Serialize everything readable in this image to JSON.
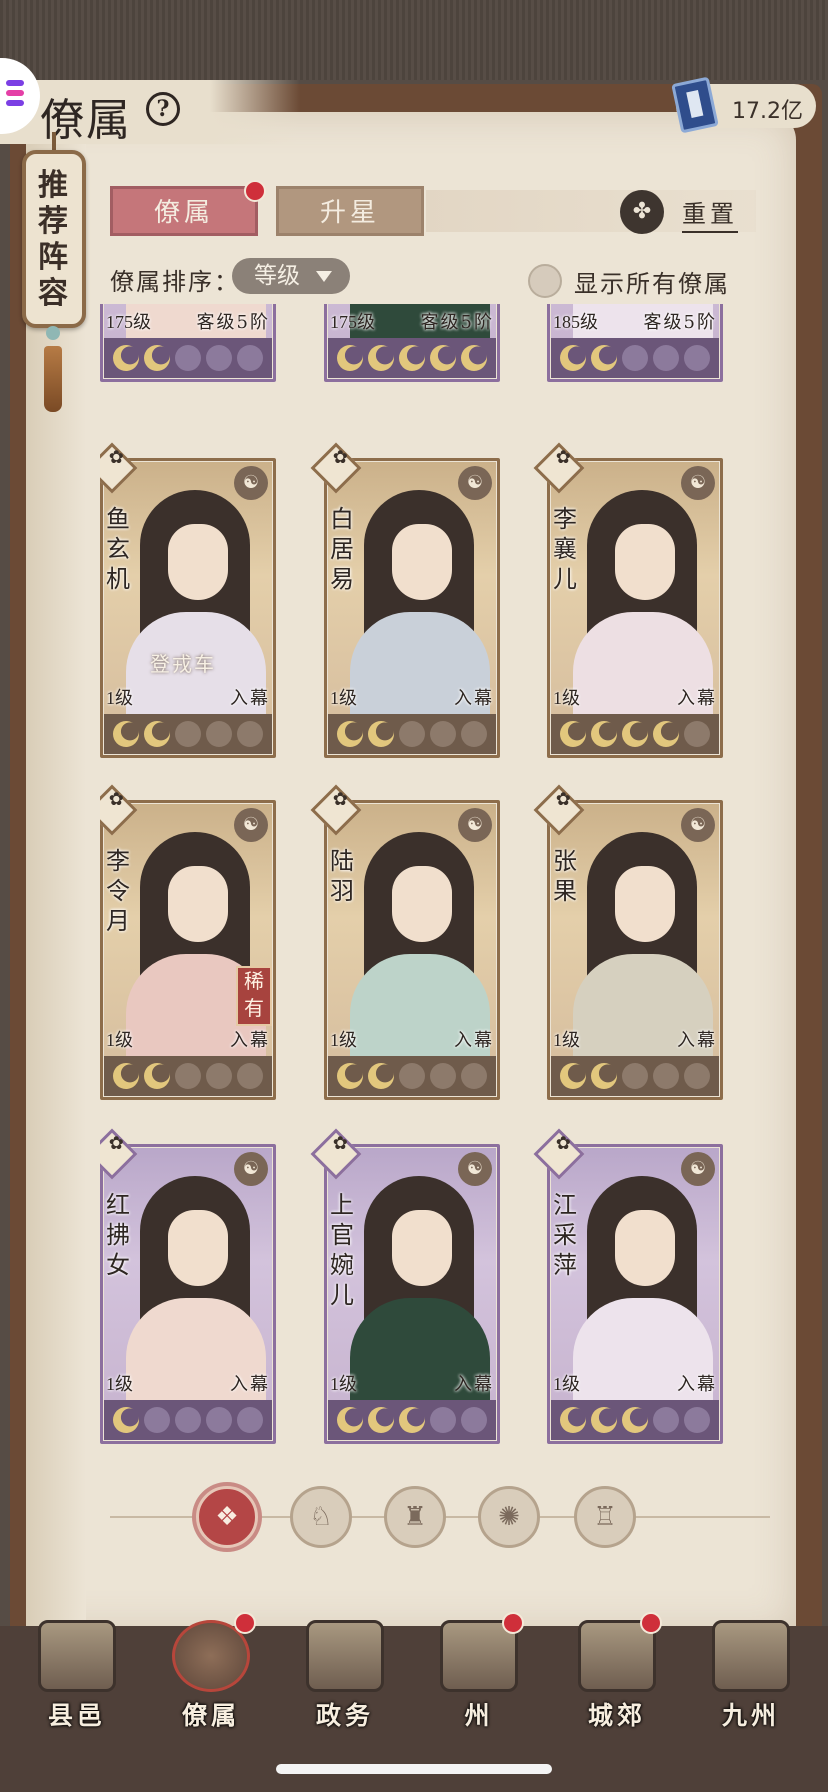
{
  "header": {
    "title": "僚属",
    "help_icon": "question-icon",
    "currency_icon": "book-icon",
    "currency_amount": "17.2亿"
  },
  "recommend": {
    "label": "推荐阵容"
  },
  "tabs": [
    {
      "label": "僚属",
      "active": true,
      "has_dot": true
    },
    {
      "label": "升星",
      "active": false,
      "has_dot": false
    }
  ],
  "reset": {
    "label": "重置",
    "icon": "leaf-icon"
  },
  "sort": {
    "label": "僚属排序：",
    "selected": "等级"
  },
  "show_all": {
    "label": "显示所有僚属",
    "checked": false
  },
  "cards": [
    {
      "name": "",
      "level": "175级",
      "status": "客级5阶",
      "moons": [
        1,
        1,
        0,
        0,
        0
      ],
      "theme": "purple"
    },
    {
      "name": "",
      "level": "175级",
      "status": "客级5阶",
      "moons": [
        1,
        1,
        1,
        1,
        1
      ],
      "theme": "purple"
    },
    {
      "name": "",
      "level": "185级",
      "status": "客级5阶",
      "moons": [
        1,
        1,
        0,
        0,
        0
      ],
      "theme": "purple"
    },
    {
      "name": "鱼玄机",
      "level": "1级",
      "status": "入幕",
      "moons": [
        1,
        1,
        0,
        0,
        0
      ],
      "theme": "gold",
      "tag": "登戎车"
    },
    {
      "name": "白居易",
      "level": "1级",
      "status": "入幕",
      "moons": [
        1,
        1,
        0,
        0,
        0
      ],
      "theme": "gold"
    },
    {
      "name": "李襄儿",
      "level": "1级",
      "status": "入幕",
      "moons": [
        1,
        1,
        1,
        1,
        0
      ],
      "theme": "gold"
    },
    {
      "name": "李令月",
      "level": "1级",
      "status": "入幕",
      "moons": [
        1,
        1,
        0,
        0,
        0
      ],
      "theme": "gold",
      "rarity": "稀有"
    },
    {
      "name": "陆羽",
      "level": "1级",
      "status": "入幕",
      "moons": [
        1,
        1,
        0,
        0,
        0
      ],
      "theme": "gold"
    },
    {
      "name": "张果",
      "level": "1级",
      "status": "入幕",
      "moons": [
        1,
        1,
        0,
        0,
        0
      ],
      "theme": "gold"
    },
    {
      "name": "红拂女",
      "level": "1级",
      "status": "入幕",
      "moons": [
        1,
        0,
        0,
        0,
        0
      ],
      "theme": "purple"
    },
    {
      "name": "上官婉儿",
      "level": "1级",
      "status": "入幕",
      "moons": [
        1,
        1,
        1,
        0,
        0
      ],
      "theme": "purple"
    },
    {
      "name": "江采萍",
      "level": "1级",
      "status": "入幕",
      "moons": [
        1,
        1,
        1,
        0,
        0
      ],
      "theme": "purple"
    }
  ],
  "faction_filters": [
    {
      "icon": "all-factions-icon",
      "glyph": "❖",
      "active": true
    },
    {
      "icon": "faction-bell-icon",
      "glyph": "♘",
      "active": false
    },
    {
      "icon": "faction-gourd-icon",
      "glyph": "♜",
      "active": false
    },
    {
      "icon": "faction-fan-icon",
      "glyph": "✺",
      "active": false
    },
    {
      "icon": "faction-pavilion-icon",
      "glyph": "♖",
      "active": false
    }
  ],
  "bottom_nav": [
    {
      "label": "县邑",
      "icon": "county-gate-icon",
      "dot": false,
      "active": false
    },
    {
      "label": "僚属",
      "icon": "retainers-icon",
      "dot": true,
      "active": true
    },
    {
      "label": "政务",
      "icon": "affairs-scroll-icon",
      "dot": false,
      "active": false
    },
    {
      "label": "州",
      "icon": "prefecture-icon",
      "dot": true,
      "active": false
    },
    {
      "label": "城郊",
      "icon": "suburb-icon",
      "dot": true,
      "active": false
    },
    {
      "label": "九州",
      "icon": "map-scroll-icon",
      "dot": false,
      "active": false
    }
  ],
  "colors": {
    "accent_red": "#c5767a",
    "notification_dot": "#cf2f3a",
    "card_gold_frame": "#8d6d4b",
    "card_purple_frame": "#8c6f9e"
  }
}
